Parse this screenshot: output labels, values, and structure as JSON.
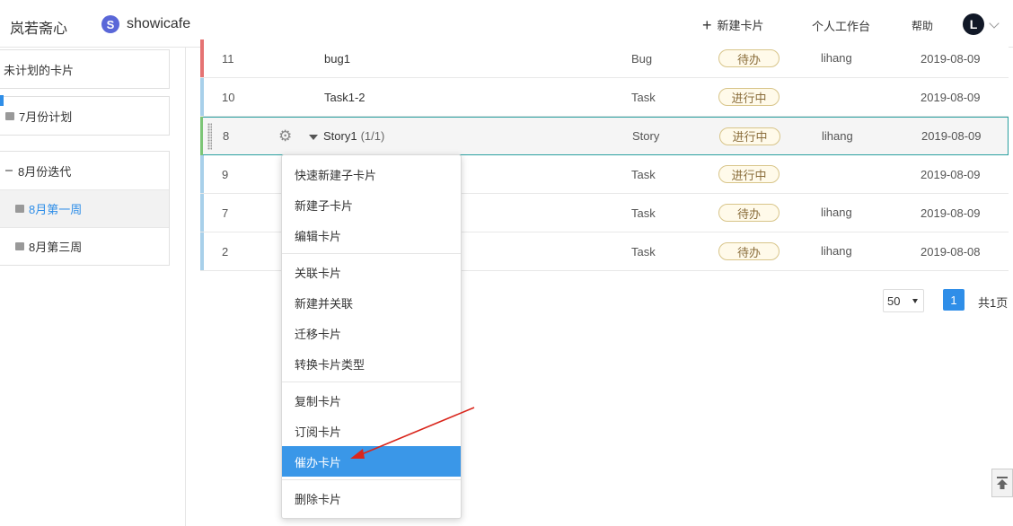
{
  "header": {
    "brand": "岚若斋心",
    "project_badge": "S",
    "project_name": "showicafe",
    "new_card": "新建卡片",
    "workspace": "个人工作台",
    "help": "帮助",
    "avatar_letter": "L"
  },
  "sidebar": {
    "unplanned": "未计划的卡片",
    "july_plan": "7月份计划",
    "aug_iter": "8月份迭代",
    "aug_week1": "8月第一周",
    "aug_week3": "8月第三周"
  },
  "rows": [
    {
      "num": "11",
      "title": "bug1",
      "type": "Bug",
      "status": "待办",
      "owner": "lihang",
      "date": "2019-08-09",
      "bar_color": "#e57373"
    },
    {
      "num": "10",
      "title": "Task1-2",
      "type": "Task",
      "status": "进行中",
      "owner": "",
      "date": "2019-08-09",
      "bar_color": "#a8d0ea"
    },
    {
      "num": "8",
      "title": "Story1",
      "count": "(1/1)",
      "type": "Story",
      "status": "进行中",
      "owner": "lihang",
      "date": "2019-08-09",
      "bar_color": "#7cc576"
    },
    {
      "num": "9",
      "title": "",
      "type": "Task",
      "status": "进行中",
      "owner": "",
      "date": "2019-08-09",
      "bar_color": "#a8d0ea"
    },
    {
      "num": "7",
      "title": "",
      "type": "Task",
      "status": "待办",
      "owner": "lihang",
      "date": "2019-08-09",
      "bar_color": "#a8d0ea"
    },
    {
      "num": "2",
      "title": "",
      "type": "Task",
      "status": "待办",
      "owner": "lihang",
      "date": "2019-08-08",
      "bar_color": "#a8d0ea"
    }
  ],
  "pagination": {
    "page_size": "50",
    "current_page": "1",
    "total": "共1页"
  },
  "menu": {
    "quick_new_child": "快速新建子卡片",
    "new_child": "新建子卡片",
    "edit": "编辑卡片",
    "link": "关联卡片",
    "new_and_link": "新建并关联",
    "migrate": "迁移卡片",
    "convert_type": "转换卡片类型",
    "copy": "复制卡片",
    "subscribe": "订阅卡片",
    "urge": "催办卡片",
    "delete": "删除卡片"
  },
  "colors": {
    "accent": "#2f8ee8",
    "menu_highlight": "#3a97e8",
    "annotation_arrow": "#d9261c"
  }
}
